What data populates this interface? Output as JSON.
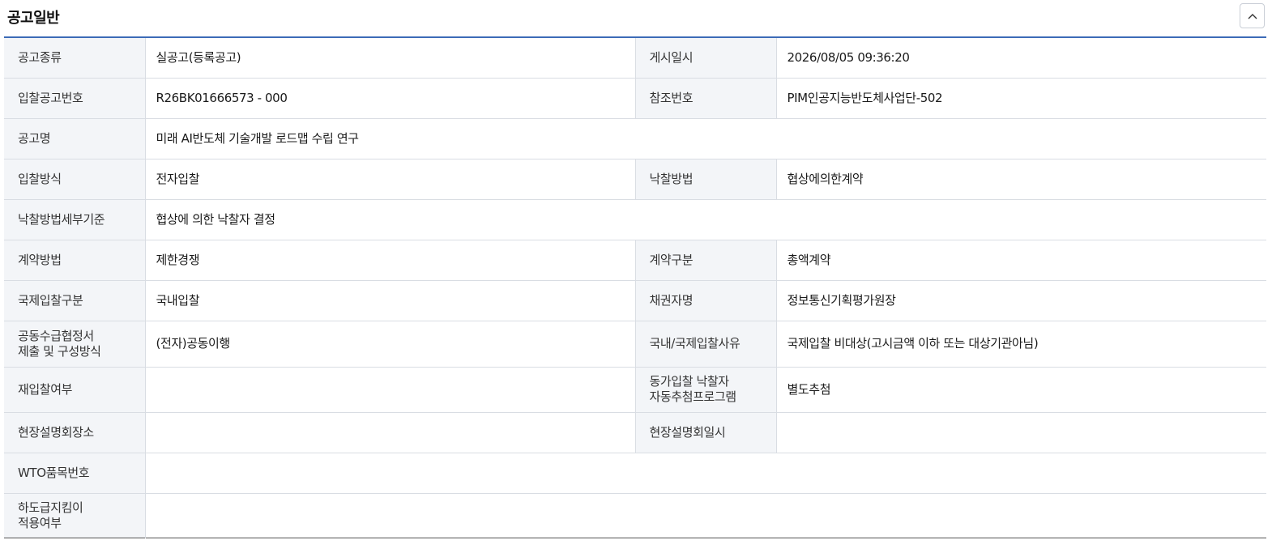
{
  "section": {
    "title": "공고일반"
  },
  "rows": [
    {
      "label1": "공고종류",
      "value1": "실공고(등록공고)",
      "label2": "게시일시",
      "value2": "2026/08/05 09:36:20"
    },
    {
      "label1": "입찰공고번호",
      "value1": "R26BK01666573 - 000",
      "label2": "참조번호",
      "value2": "PIM인공지능반도체사업단-502"
    },
    {
      "label1": "공고명",
      "value1": "미래 AI반도체 기술개발 로드맵 수립 연구"
    },
    {
      "label1": "입찰방식",
      "value1": "전자입찰",
      "label2": "낙찰방법",
      "value2": "협상에의한계약"
    },
    {
      "label1": "낙찰방법세부기준",
      "value1": "협상에 의한 낙찰자 결정"
    },
    {
      "label1": "계약방법",
      "value1": "제한경쟁",
      "label2": "계약구분",
      "value2": "총액계약"
    },
    {
      "label1": "국제입찰구분",
      "value1": "국내입찰",
      "label2": "채권자명",
      "value2": "정보통신기획평가원장"
    },
    {
      "label1a": "공동수급협정서",
      "label1b": "제출 및 구성방식",
      "value1": "(전자)공동이행",
      "label2": "국내/국제입찰사유",
      "value2": "국제입찰 비대상(고시금액 이하 또는 대상기관아님)"
    },
    {
      "label1": "재입찰여부",
      "value1": "",
      "label2a": "동가입찰 낙찰자",
      "label2b": "자동추첨프로그램",
      "value2": "별도추첨"
    },
    {
      "label1": "현장설명회장소",
      "value1": "",
      "label2": "현장설명회일시",
      "value2": ""
    },
    {
      "label1": "WTO품목번호",
      "value1": ""
    },
    {
      "label1a": "하도급지킴이",
      "label1b": "적용여부",
      "value1": ""
    }
  ]
}
